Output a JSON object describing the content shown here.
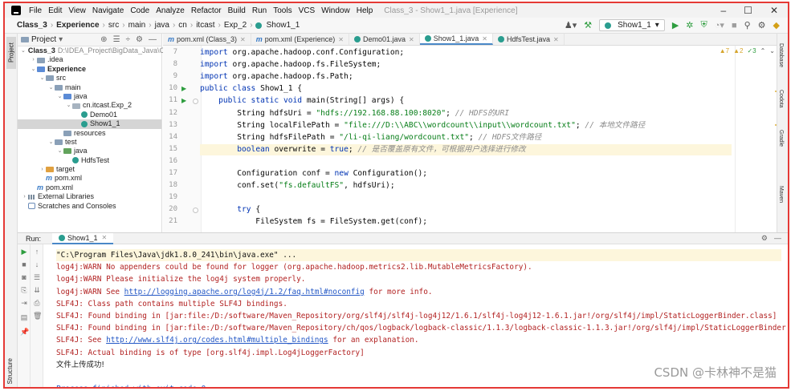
{
  "menubar": {
    "items": [
      "File",
      "Edit",
      "View",
      "Navigate",
      "Code",
      "Analyze",
      "Refactor",
      "Build",
      "Run",
      "Tools",
      "VCS",
      "Window",
      "Help"
    ],
    "title": "Class_3 - Show1_1.java [Experience]",
    "win_min": "–",
    "win_max": "☐",
    "win_close": "✕"
  },
  "breadcrumb": {
    "items": [
      "Class_3",
      "Experience",
      "src",
      "main",
      "java",
      "cn",
      "itcast",
      "Exp_2",
      "Show1_1"
    ]
  },
  "toolbar": {
    "run_config": "Show1_1",
    "run_config_arrow": "▾"
  },
  "left_strip": {
    "project_tab": "Project",
    "structure_tab": "Structure"
  },
  "right_strip": {
    "labels": [
      "Database",
      "Codota",
      "Gradle",
      "Maven"
    ]
  },
  "project_panel": {
    "title": "Project",
    "title_arrow": "▾",
    "tree": [
      {
        "label": "Class_3",
        "extra": "D:\\IDEA_Project\\BigData_Java\\Class_3",
        "indent": 0,
        "arrow": "v",
        "icon": "folder",
        "bold": true
      },
      {
        "label": ".idea",
        "indent": 1,
        "arrow": ">",
        "icon": "folder"
      },
      {
        "label": "Experience",
        "indent": 1,
        "arrow": "v",
        "icon": "folder-blue",
        "bold": true
      },
      {
        "label": "src",
        "indent": 2,
        "arrow": "v",
        "icon": "folder"
      },
      {
        "label": "main",
        "indent": 3,
        "arrow": "v",
        "icon": "folder"
      },
      {
        "label": "java",
        "indent": 4,
        "arrow": "v",
        "icon": "folder-blue"
      },
      {
        "label": "cn.itcast.Exp_2",
        "indent": 5,
        "arrow": "v",
        "icon": "pkg"
      },
      {
        "label": "Demo01",
        "indent": 6,
        "arrow": "",
        "icon": "class"
      },
      {
        "label": "Show1_1",
        "indent": 6,
        "arrow": "",
        "icon": "class",
        "selected": true
      },
      {
        "label": "resources",
        "indent": 4,
        "arrow": "",
        "icon": "folder"
      },
      {
        "label": "test",
        "indent": 3,
        "arrow": "v",
        "icon": "folder"
      },
      {
        "label": "java",
        "indent": 4,
        "arrow": "v",
        "icon": "folder-green"
      },
      {
        "label": "HdfsTest",
        "indent": 5,
        "arrow": "",
        "icon": "class"
      },
      {
        "label": "target",
        "indent": 2,
        "arrow": ">",
        "icon": "folder-orange"
      },
      {
        "label": "pom.xml",
        "indent": 2,
        "arrow": "",
        "icon": "mvn"
      },
      {
        "label": "pom.xml",
        "indent": 1,
        "arrow": "",
        "icon": "mvn"
      },
      {
        "label": "External Libraries",
        "indent": 0,
        "arrow": ">",
        "icon": "lib"
      },
      {
        "label": "Scratches and Consoles",
        "indent": 0,
        "arrow": "",
        "icon": "scratch"
      }
    ]
  },
  "editor": {
    "tabs": [
      {
        "label": "pom.xml (Class_3)",
        "icon": "mvn",
        "active": false
      },
      {
        "label": "pom.xml (Experience)",
        "icon": "mvn",
        "active": false
      },
      {
        "label": "Demo01.java",
        "icon": "class",
        "active": false
      },
      {
        "label": "Show1_1.java",
        "icon": "class",
        "active": true
      },
      {
        "label": "HdfsTest.java",
        "icon": "class",
        "active": false
      }
    ],
    "inspections": {
      "warnings": "▲7",
      "weak": "▲2",
      "ok": "✓3"
    },
    "lines": [
      {
        "no": "7",
        "tokens": [
          [
            "kw",
            "import "
          ],
          [
            "",
            "org.apache.hadoop.conf.Configuration;"
          ]
        ]
      },
      {
        "no": "8",
        "tokens": [
          [
            "kw",
            "import "
          ],
          [
            "",
            "org.apache.hadoop.fs.FileSystem;"
          ]
        ]
      },
      {
        "no": "9",
        "tokens": [
          [
            "kw",
            "import "
          ],
          [
            "",
            "org.apache.hadoop.fs.Path;"
          ]
        ]
      },
      {
        "no": "10",
        "run": true,
        "tokens": [
          [
            "kw",
            "public class "
          ],
          [
            "",
            "Show1_1 {"
          ]
        ]
      },
      {
        "no": "11",
        "run": true,
        "fold": true,
        "tokens": [
          [
            "",
            "    "
          ],
          [
            "kw",
            "public static void "
          ],
          [
            "",
            "main(String[] args) {"
          ]
        ]
      },
      {
        "no": "12",
        "tokens": [
          [
            "",
            "        String hdfsUri = "
          ],
          [
            "str",
            "\"hdfs://192.168.88.100:8020\""
          ],
          [
            "",
            "; "
          ],
          [
            "cmt",
            "// HDFS的URI"
          ]
        ]
      },
      {
        "no": "13",
        "tokens": [
          [
            "",
            "        String localFilePath = "
          ],
          [
            "str",
            "\"file:///D:\\\\ABC\\\\wordcount\\\\input\\\\wordcount.txt\""
          ],
          [
            "",
            "; "
          ],
          [
            "cmt",
            "// 本地文件路径"
          ]
        ]
      },
      {
        "no": "14",
        "tokens": [
          [
            "",
            "        String hdfsFilePath = "
          ],
          [
            "str",
            "\"/li-qi-liang/wordcount.txt\""
          ],
          [
            "",
            "; "
          ],
          [
            "cmt",
            "// HDFS文件路径"
          ]
        ]
      },
      {
        "no": "15",
        "hl": true,
        "tokens": [
          [
            "",
            "        "
          ],
          [
            "kw",
            "boolean "
          ],
          [
            "",
            "overwrite = "
          ],
          [
            "kw",
            "true"
          ],
          [
            "",
            "; "
          ],
          [
            "cmt",
            "// 是否覆盖原有文件，可根据用户选择进行修改"
          ]
        ]
      },
      {
        "no": "16",
        "tokens": []
      },
      {
        "no": "17",
        "tokens": [
          [
            "",
            "        Configuration conf = "
          ],
          [
            "kw",
            "new "
          ],
          [
            "",
            "Configuration();"
          ]
        ]
      },
      {
        "no": "18",
        "tokens": [
          [
            "",
            "        conf.set("
          ],
          [
            "str",
            "\"fs.defaultFS\""
          ],
          [
            "",
            ", hdfsUri);"
          ]
        ]
      },
      {
        "no": "19",
        "tokens": []
      },
      {
        "no": "20",
        "fold": true,
        "tokens": [
          [
            "",
            "        "
          ],
          [
            "kw",
            "try "
          ],
          [
            "",
            "{"
          ]
        ]
      },
      {
        "no": "21",
        "tokens": [
          [
            "",
            "            FileSystem fs = FileSystem."
          ],
          [
            "kw",
            ""
          ],
          [
            "",
            "get(conf);"
          ]
        ]
      }
    ]
  },
  "run_panel": {
    "label": "Run:",
    "tab": "Show1_1",
    "console": [
      {
        "type": "cmd",
        "text": "\"C:\\Program Files\\Java\\jdk1.8.0_241\\bin\\java.exe\" ..."
      },
      {
        "type": "err",
        "text": "log4j:WARN No appenders could be found for logger (org.apache.hadoop.metrics2.lib.MutableMetricsFactory)."
      },
      {
        "type": "err",
        "text": "log4j:WARN Please initialize the log4j system properly."
      },
      {
        "type": "err-link",
        "pre": "log4j:WARN See ",
        "link": "http://logging.apache.org/log4j/1.2/faq.html#noconfig",
        "post": " for more info."
      },
      {
        "type": "err",
        "text": "SLF4J: Class path contains multiple SLF4J bindings."
      },
      {
        "type": "err",
        "text": "SLF4J: Found binding in [jar:file:/D:/software/Maven_Repository/org/slf4j/slf4j-log4j12/1.6.1/slf4j-log4j12-1.6.1.jar!/org/slf4j/impl/StaticLoggerBinder.class]"
      },
      {
        "type": "err",
        "text": "SLF4J: Found binding in [jar:file:/D:/software/Maven_Repository/ch/qos/logback/logback-classic/1.1.3/logback-classic-1.1.3.jar!/org/slf4j/impl/StaticLoggerBinder.class]"
      },
      {
        "type": "err-link",
        "pre": "SLF4J: See ",
        "link": "http://www.slf4j.org/codes.html#multiple_bindings",
        "post": " for an explanation."
      },
      {
        "type": "err",
        "text": "SLF4J: Actual binding is of type [org.slf4j.impl.Log4jLoggerFactory]"
      },
      {
        "type": "plain",
        "text": "文件上传成功!"
      },
      {
        "type": "blank",
        "text": ""
      },
      {
        "type": "ok",
        "text": "Process finished with exit code 0"
      }
    ]
  },
  "watermark": "CSDN @卡林神不是猫"
}
